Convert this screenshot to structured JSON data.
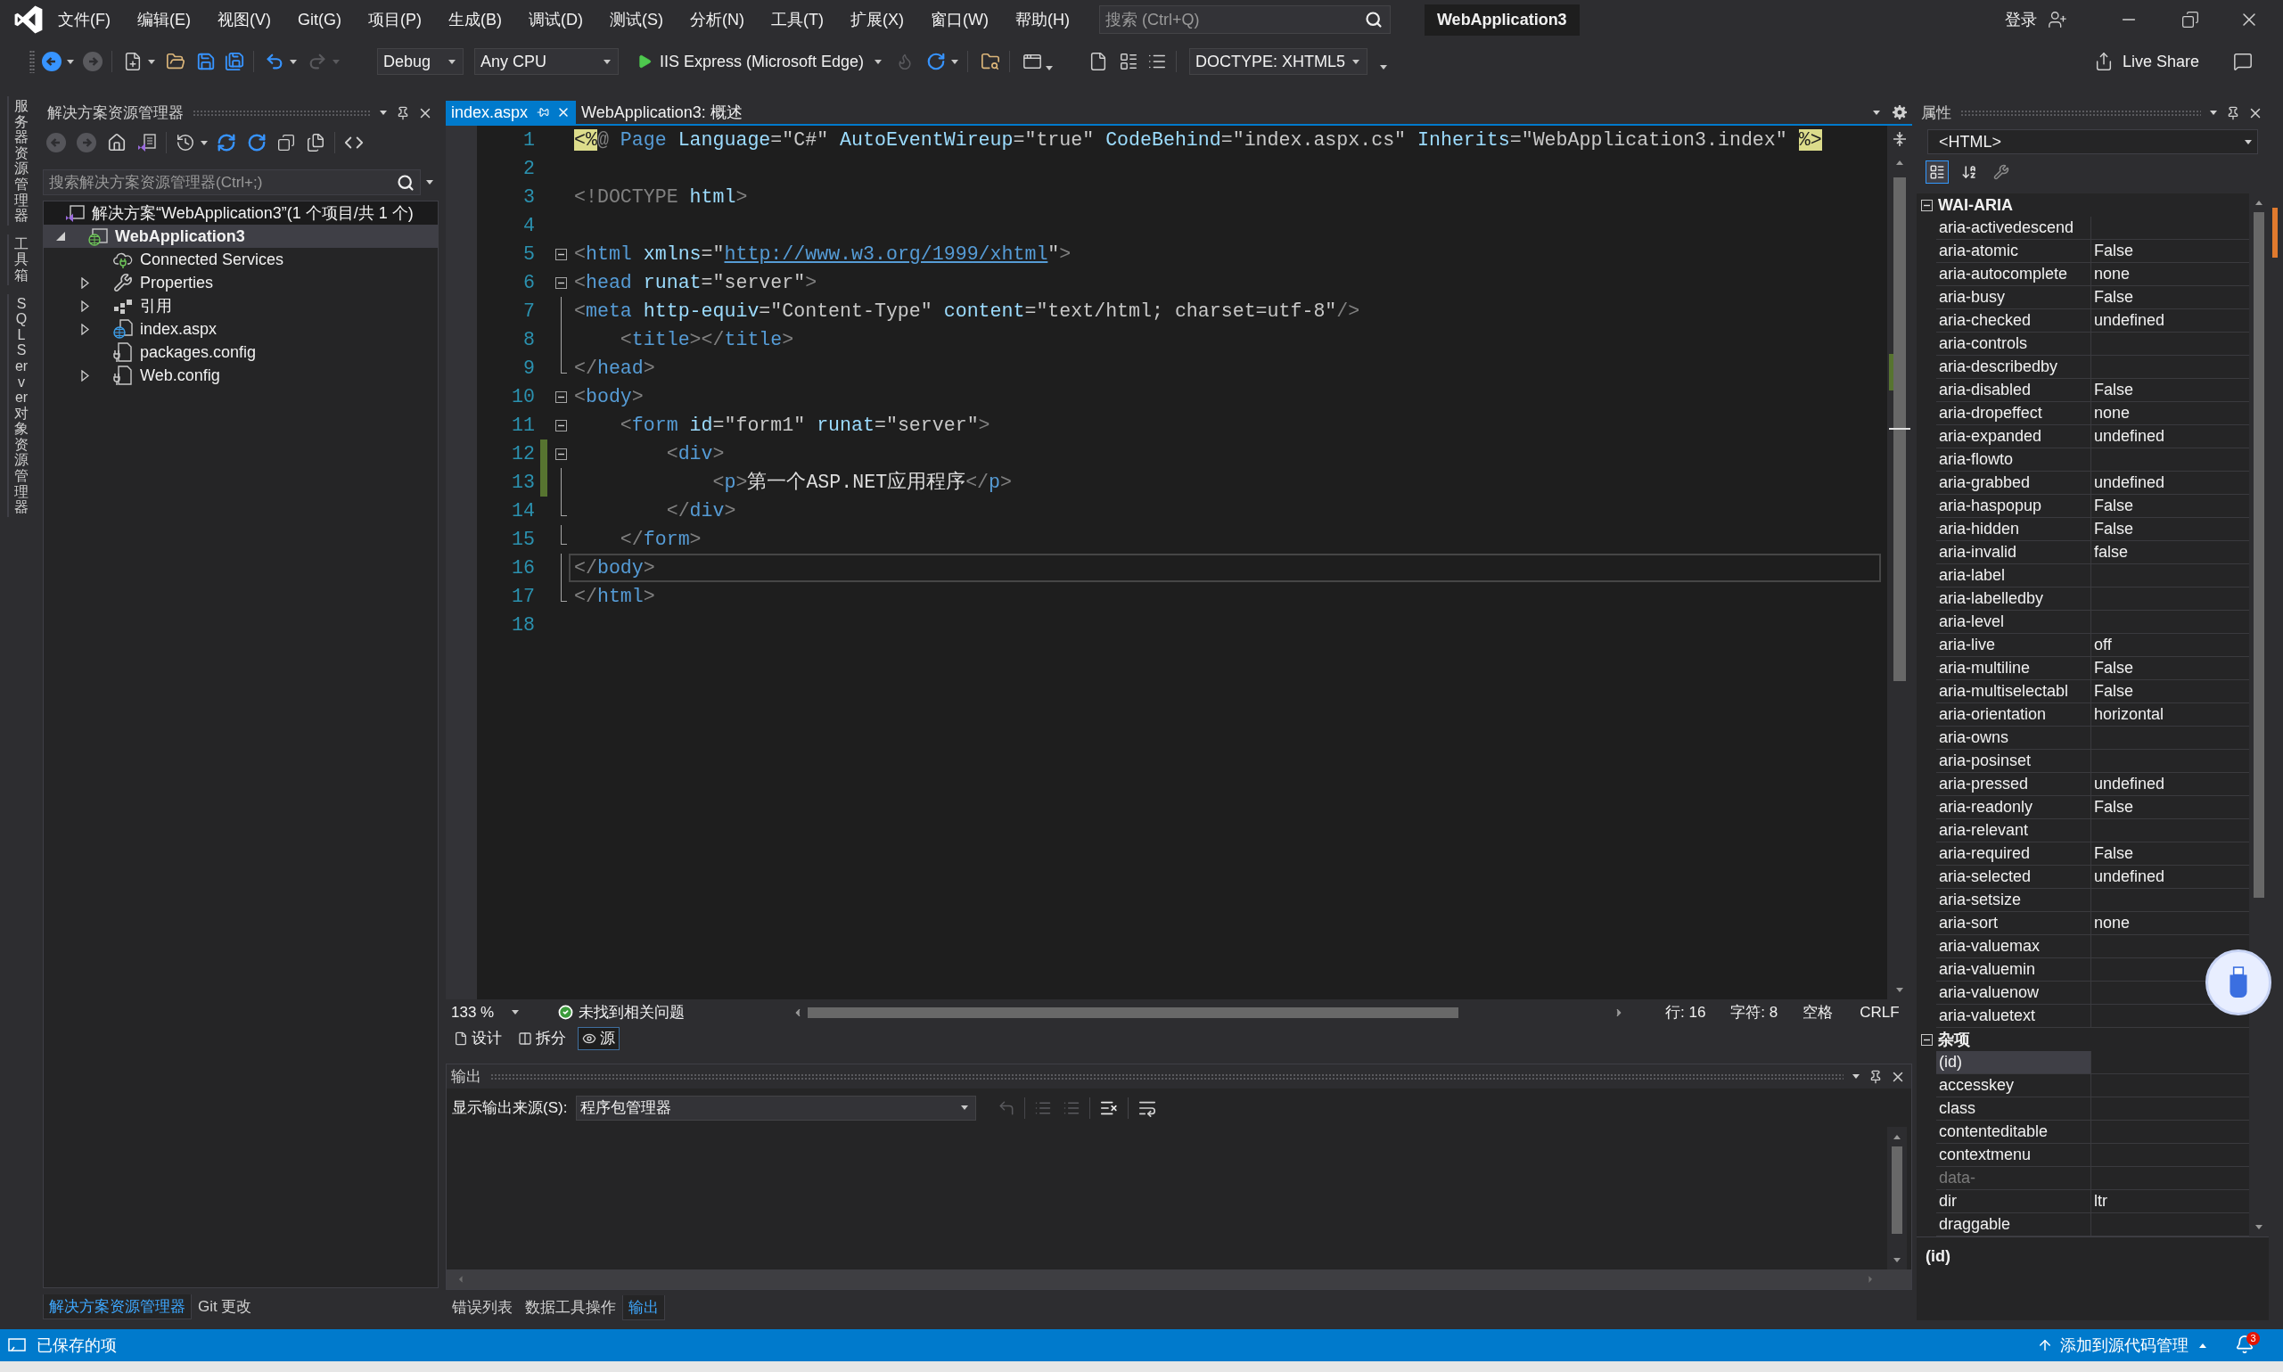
{
  "title_bar": {
    "menu": [
      "文件(F)",
      "编辑(E)",
      "视图(V)",
      "Git(G)",
      "项目(P)",
      "生成(B)",
      "调试(D)",
      "测试(S)",
      "分析(N)",
      "工具(T)",
      "扩展(X)",
      "窗口(W)",
      "帮助(H)"
    ],
    "search": {
      "placeholder": "搜索 (Ctrl+Q)"
    },
    "solution_name": "WebApplication3",
    "sign_in": "登录"
  },
  "toolbar": {
    "configuration": "Debug",
    "platform": "Any CPU",
    "run_target": "IIS Express (Microsoft Edge)",
    "doctype": "DOCTYPE: XHTML5",
    "live_share": "Live Share"
  },
  "side_tabs": [
    "服务器资源管理器",
    "工具箱",
    "SQL Server 对象资源管理器"
  ],
  "solution_explorer": {
    "title": "解决方案资源管理器",
    "search": {
      "placeholder": "搜索解决方案资源管理器(Ctrl+;)"
    },
    "tree": [
      {
        "label": "解决方案“WebApplication3”(1 个项目/共 1 个)",
        "kind": "solution",
        "selected": false,
        "children": [
          {
            "label": "WebApplication3",
            "kind": "project",
            "expanded": true,
            "selected": true,
            "children": [
              {
                "label": "Connected Services",
                "kind": "connected_services",
                "selected": false
              },
              {
                "label": "Properties",
                "kind": "properties",
                "expanded": false,
                "selected": false
              },
              {
                "label": "引用",
                "kind": "references",
                "expanded": false,
                "selected": false
              },
              {
                "label": "index.aspx",
                "kind": "aspx",
                "expanded": false,
                "selected": false
              },
              {
                "label": "packages.config",
                "kind": "config",
                "selected": false
              },
              {
                "label": "Web.config",
                "kind": "config",
                "expanded": false,
                "selected": false
              }
            ]
          }
        ]
      }
    ],
    "tabs": [
      {
        "label": "解决方案资源管理器",
        "selected": true
      },
      {
        "label": "Git 更改",
        "selected": false
      }
    ]
  },
  "editor": {
    "tabs": [
      {
        "label": "index.aspx",
        "selected": true
      },
      {
        "label": "WebApplication3: 概述",
        "selected": false
      }
    ],
    "lines": [
      {
        "number": "1",
        "kind": "plain",
        "changed": false,
        "current": false,
        "tokens": [
          {
            "kind": "delim",
            "text": "<%"
          },
          {
            "kind": "punct",
            "text": "@"
          },
          {
            "kind": "tag",
            "text": " Page"
          },
          {
            "kind": "attr",
            "text": " Language"
          },
          {
            "kind": "value",
            "text": "=\"C#\""
          },
          {
            "kind": "attr",
            "text": " AutoEventWireup"
          },
          {
            "kind": "value",
            "text": "=\"true\""
          },
          {
            "kind": "attr",
            "text": " CodeBehind"
          },
          {
            "kind": "value",
            "text": "=\"index.aspx.cs\""
          },
          {
            "kind": "attr",
            "text": " Inherits"
          },
          {
            "kind": "value",
            "text": "=\"WebApplication3.index\" "
          },
          {
            "kind": "delim",
            "text": "%>"
          }
        ]
      },
      {
        "number": "2",
        "kind": "plain",
        "changed": false,
        "current": false
      },
      {
        "number": "3",
        "kind": "plain",
        "changed": false,
        "current": false,
        "tokens": [
          {
            "kind": "punct",
            "text": "<!DOCTYPE"
          },
          {
            "kind": "attr",
            "text": " html"
          },
          {
            "kind": "punct",
            "text": ">"
          }
        ]
      },
      {
        "number": "4",
        "kind": "plain",
        "changed": false,
        "current": false
      },
      {
        "number": "5",
        "kind": "fold_start",
        "changed": false,
        "current": false,
        "tokens": [
          {
            "kind": "punct",
            "text": "<"
          },
          {
            "kind": "tag",
            "text": "html"
          },
          {
            "kind": "attr",
            "text": " xmlns"
          },
          {
            "kind": "value",
            "text": "=\""
          },
          {
            "kind": "link",
            "text": "http://www.w3.org/1999/xhtml"
          },
          {
            "kind": "value",
            "text": "\""
          },
          {
            "kind": "punct",
            "text": ">"
          }
        ]
      },
      {
        "number": "6",
        "kind": "fold_start",
        "changed": false,
        "current": false,
        "tokens": [
          {
            "kind": "punct",
            "text": "<"
          },
          {
            "kind": "tag",
            "text": "head"
          },
          {
            "kind": "attr",
            "text": " runat"
          },
          {
            "kind": "value",
            "text": "=\"server\""
          },
          {
            "kind": "punct",
            "text": ">"
          }
        ]
      },
      {
        "number": "7",
        "kind": "fold_line",
        "changed": false,
        "current": false,
        "tokens": [
          {
            "kind": "punct",
            "text": "<"
          },
          {
            "kind": "tag",
            "text": "meta"
          },
          {
            "kind": "attr",
            "text": " http-equiv"
          },
          {
            "kind": "value",
            "text": "=\"Content-Type\""
          },
          {
            "kind": "attr",
            "text": " content"
          },
          {
            "kind": "value",
            "text": "=\"text/html; charset=utf-8\""
          },
          {
            "kind": "punct",
            "text": "/>"
          }
        ]
      },
      {
        "number": "8",
        "kind": "fold_line",
        "changed": false,
        "current": false,
        "tokens": [
          {
            "kind": "punct",
            "text": "    <"
          },
          {
            "kind": "tag",
            "text": "title"
          },
          {
            "kind": "punct",
            "text": "></"
          },
          {
            "kind": "tag",
            "text": "title"
          },
          {
            "kind": "punct",
            "text": ">"
          }
        ]
      },
      {
        "number": "9",
        "kind": "fold_end",
        "changed": false,
        "current": false,
        "tokens": [
          {
            "kind": "punct",
            "text": "</"
          },
          {
            "kind": "tag",
            "text": "head"
          },
          {
            "kind": "punct",
            "text": ">"
          }
        ]
      },
      {
        "number": "10",
        "kind": "fold_start",
        "changed": false,
        "current": false,
        "tokens": [
          {
            "kind": "punct",
            "text": "<"
          },
          {
            "kind": "tag",
            "text": "body"
          },
          {
            "kind": "punct",
            "text": ">"
          }
        ]
      },
      {
        "number": "11",
        "kind": "fold_start",
        "changed": false,
        "current": false,
        "tokens": [
          {
            "kind": "punct",
            "text": "    <"
          },
          {
            "kind": "tag",
            "text": "form"
          },
          {
            "kind": "attr",
            "text": " id"
          },
          {
            "kind": "value",
            "text": "=\"form1\""
          },
          {
            "kind": "attr",
            "text": " runat"
          },
          {
            "kind": "value",
            "text": "=\"server\""
          },
          {
            "kind": "punct",
            "text": ">"
          }
        ]
      },
      {
        "number": "12",
        "kind": "fold_start",
        "changed": true,
        "current": false,
        "tokens": [
          {
            "kind": "punct",
            "text": "        <"
          },
          {
            "kind": "tag",
            "text": "div"
          },
          {
            "kind": "punct",
            "text": ">"
          }
        ]
      },
      {
        "number": "13",
        "kind": "fold_line",
        "changed": true,
        "current": false,
        "tokens": [
          {
            "kind": "punct",
            "text": "            <"
          },
          {
            "kind": "tag",
            "text": "p"
          },
          {
            "kind": "punct",
            "text": ">"
          },
          {
            "kind": "text",
            "text": "第一个ASP.NET应用程序"
          },
          {
            "kind": "punct",
            "text": "</"
          },
          {
            "kind": "tag",
            "text": "p"
          },
          {
            "kind": "punct",
            "text": ">"
          }
        ]
      },
      {
        "number": "14",
        "kind": "fold_end",
        "changed": false,
        "current": false,
        "tokens": [
          {
            "kind": "punct",
            "text": "        </"
          },
          {
            "kind": "tag",
            "text": "div"
          },
          {
            "kind": "punct",
            "text": ">"
          }
        ]
      },
      {
        "number": "15",
        "kind": "fold_end",
        "changed": false,
        "current": false,
        "tokens": [
          {
            "kind": "punct",
            "text": "    </"
          },
          {
            "kind": "tag",
            "text": "form"
          },
          {
            "kind": "punct",
            "text": ">"
          }
        ]
      },
      {
        "number": "16",
        "kind": "fold_line",
        "changed": false,
        "current": true,
        "tokens": [
          {
            "kind": "punct",
            "text": "</"
          },
          {
            "kind": "tag",
            "text": "body"
          },
          {
            "kind": "punct",
            "text": ">"
          }
        ]
      },
      {
        "number": "17",
        "kind": "fold_end",
        "changed": false,
        "current": false,
        "tokens": [
          {
            "kind": "punct",
            "text": "</"
          },
          {
            "kind": "tag",
            "text": "html"
          },
          {
            "kind": "punct",
            "text": ">"
          }
        ]
      },
      {
        "number": "18",
        "kind": "plain",
        "changed": false,
        "current": false
      }
    ],
    "status": {
      "zoom": "133 %",
      "issues": "未找到相关问题",
      "line": "行: 16",
      "column": "字符: 8",
      "indent": "空格",
      "line_ending": "CRLF"
    },
    "view_tabs": [
      {
        "label": "设计",
        "kind": "design",
        "selected": false
      },
      {
        "label": "拆分",
        "kind": "split",
        "selected": false
      },
      {
        "label": "源",
        "kind": "source",
        "selected": true
      }
    ]
  },
  "output": {
    "title": "输出",
    "source_label": "显示输出来源(S):",
    "source": "程序包管理器",
    "tabs": [
      {
        "label": "错误列表",
        "selected": false
      },
      {
        "label": "数据工具操作",
        "selected": false
      },
      {
        "label": "输出",
        "selected": true
      }
    ]
  },
  "properties": {
    "title": "属性",
    "object": "<HTML>",
    "view_buttons": [
      {
        "kind": "categorized",
        "selected": true
      },
      {
        "kind": "alphabetical",
        "selected": false
      },
      {
        "kind": "property_pages",
        "selected": false
      }
    ],
    "categories": [
      {
        "name": "WAI-ARIA",
        "expanded": true,
        "rows": [
          {
            "name": "aria-activedescend",
            "selected": false,
            "disabled": false
          },
          {
            "name": "aria-atomic",
            "value": "False",
            "selected": false,
            "disabled": false
          },
          {
            "name": "aria-autocomplete",
            "value": "none",
            "selected": false,
            "disabled": false
          },
          {
            "name": "aria-busy",
            "value": "False",
            "selected": false,
            "disabled": false
          },
          {
            "name": "aria-checked",
            "value": "undefined",
            "selected": false,
            "disabled": false
          },
          {
            "name": "aria-controls",
            "selected": false,
            "disabled": false
          },
          {
            "name": "aria-describedby",
            "selected": false,
            "disabled": false
          },
          {
            "name": "aria-disabled",
            "value": "False",
            "selected": false,
            "disabled": false
          },
          {
            "name": "aria-dropeffect",
            "value": "none",
            "selected": false,
            "disabled": false
          },
          {
            "name": "aria-expanded",
            "value": "undefined",
            "selected": false,
            "disabled": false
          },
          {
            "name": "aria-flowto",
            "selected": false,
            "disabled": false
          },
          {
            "name": "aria-grabbed",
            "value": "undefined",
            "selected": false,
            "disabled": false
          },
          {
            "name": "aria-haspopup",
            "value": "False",
            "selected": false,
            "disabled": false
          },
          {
            "name": "aria-hidden",
            "value": "False",
            "selected": false,
            "disabled": false
          },
          {
            "name": "aria-invalid",
            "value": "false",
            "selected": false,
            "disabled": false
          },
          {
            "name": "aria-label",
            "selected": false,
            "disabled": false
          },
          {
            "name": "aria-labelledby",
            "selected": false,
            "disabled": false
          },
          {
            "name": "aria-level",
            "selected": false,
            "disabled": false
          },
          {
            "name": "aria-live",
            "value": "off",
            "selected": false,
            "disabled": false
          },
          {
            "name": "aria-multiline",
            "value": "False",
            "selected": false,
            "disabled": false
          },
          {
            "name": "aria-multiselectabl",
            "value": "False",
            "selected": false,
            "disabled": false
          },
          {
            "name": "aria-orientation",
            "value": "horizontal",
            "selected": false,
            "disabled": false
          },
          {
            "name": "aria-owns",
            "selected": false,
            "disabled": false
          },
          {
            "name": "aria-posinset",
            "selected": false,
            "disabled": false
          },
          {
            "name": "aria-pressed",
            "value": "undefined",
            "selected": false,
            "disabled": false
          },
          {
            "name": "aria-readonly",
            "value": "False",
            "selected": false,
            "disabled": false
          },
          {
            "name": "aria-relevant",
            "selected": false,
            "disabled": false
          },
          {
            "name": "aria-required",
            "value": "False",
            "selected": false,
            "disabled": false
          },
          {
            "name": "aria-selected",
            "value": "undefined",
            "selected": false,
            "disabled": false
          },
          {
            "name": "aria-setsize",
            "selected": false,
            "disabled": false
          },
          {
            "name": "aria-sort",
            "value": "none",
            "selected": false,
            "disabled": false
          },
          {
            "name": "aria-valuemax",
            "selected": false,
            "disabled": false
          },
          {
            "name": "aria-valuemin",
            "selected": false,
            "disabled": false
          },
          {
            "name": "aria-valuenow",
            "selected": false,
            "disabled": false
          },
          {
            "name": "aria-valuetext",
            "selected": false,
            "disabled": false
          }
        ]
      },
      {
        "name": "杂项",
        "expanded": true,
        "rows": [
          {
            "name": "(id)",
            "selected": true,
            "disabled": false
          },
          {
            "name": "accesskey",
            "selected": false,
            "disabled": false
          },
          {
            "name": "class",
            "selected": false,
            "disabled": false
          },
          {
            "name": "contenteditable",
            "selected": false,
            "disabled": false
          },
          {
            "name": "contextmenu",
            "selected": false,
            "disabled": false
          },
          {
            "name": "data-",
            "selected": false,
            "disabled": true
          },
          {
            "name": "dir",
            "value": "ltr",
            "selected": false,
            "disabled": false
          },
          {
            "name": "draggable",
            "selected": false,
            "disabled": false
          }
        ]
      }
    ],
    "description": "(id)"
  },
  "status_bar": {
    "message": "已保存的项",
    "source_control": "添加到源代码管理",
    "notifications": "3"
  }
}
